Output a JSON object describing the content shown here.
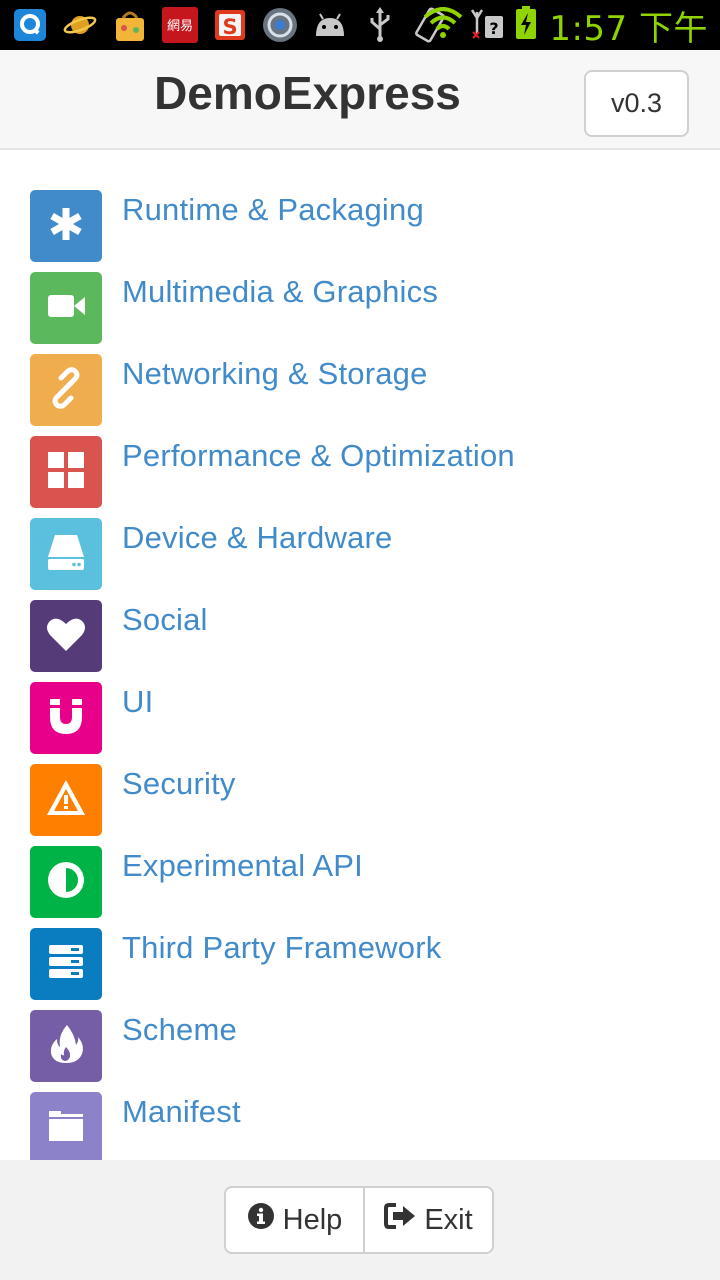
{
  "statusbar": {
    "notification_icons": [
      "qq-icon",
      "planet-icon",
      "shopping-bag-icon",
      "netease-icon",
      "sogou-s-icon",
      "sync-icon",
      "android-icon",
      "usb-icon",
      "rotate-icon"
    ],
    "time": "1:57 下午"
  },
  "header": {
    "title": "DemoExpress",
    "version": "v0.3"
  },
  "menu": {
    "items": [
      {
        "label": "Runtime & Packaging",
        "icon": "asterisk-icon",
        "color": "#428bca"
      },
      {
        "label": "Multimedia & Graphics",
        "icon": "video-camera-icon",
        "color": "#5cb85c"
      },
      {
        "label": "Networking & Storage",
        "icon": "link-icon",
        "color": "#f0ad4e"
      },
      {
        "label": "Performance & Optimization",
        "icon": "grid-icon",
        "color": "#d9534f"
      },
      {
        "label": "Device & Hardware",
        "icon": "hard-drive-icon",
        "color": "#5bc0de"
      },
      {
        "label": "Social",
        "icon": "heart-icon",
        "color": "#553c78"
      },
      {
        "label": "UI",
        "icon": "magnet-icon",
        "color": "#e8008a"
      },
      {
        "label": "Security",
        "icon": "warning-icon",
        "color": "#ff8000"
      },
      {
        "label": "Experimental API",
        "icon": "contrast-icon",
        "color": "#00b346"
      },
      {
        "label": "Third Party Framework",
        "icon": "server-icon",
        "color": "#0a7dc1"
      },
      {
        "label": "Scheme",
        "icon": "fire-icon",
        "color": "#765ea7"
      },
      {
        "label": "Manifest",
        "icon": "folder-icon",
        "color": "#8b82c9"
      }
    ]
  },
  "footer": {
    "help_label": "Help",
    "exit_label": "Exit"
  }
}
